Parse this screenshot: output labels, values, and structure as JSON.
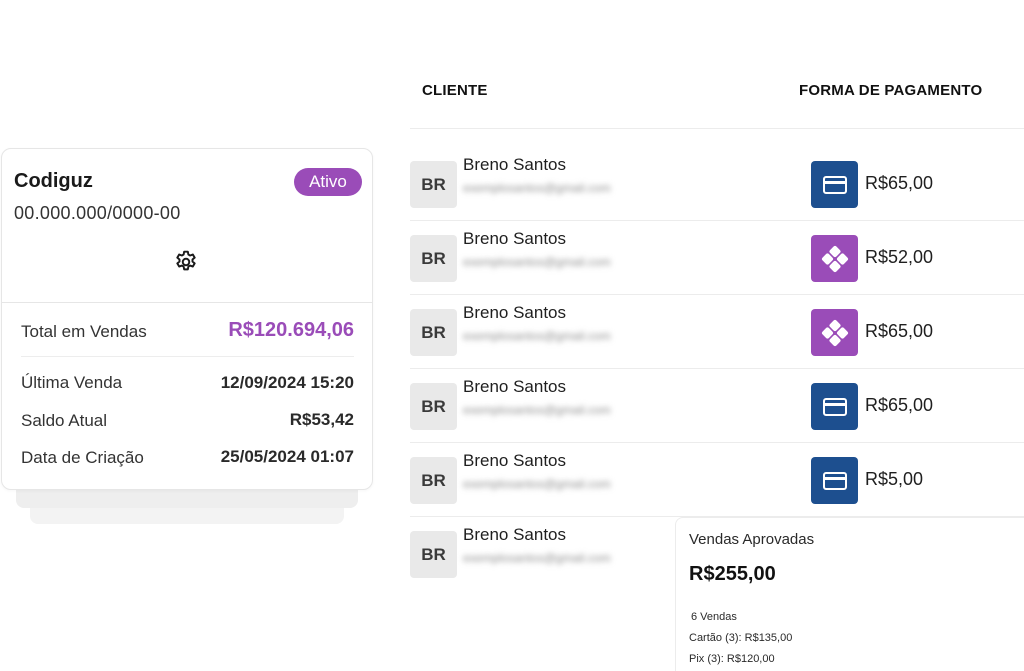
{
  "table": {
    "col_client": "CLIENTE",
    "col_payment": "FORMA DE PAGAMENTO",
    "rows": [
      {
        "initials": "BR",
        "name": "Breno Santos",
        "email": "exemplosantos@gmail.com",
        "method_icon": "credit-card-icon",
        "amount": "R$65,00"
      },
      {
        "initials": "BR",
        "name": "Breno Santos",
        "email": "exemplosantos@gmail.com",
        "method_icon": "pix-icon",
        "amount": "R$52,00"
      },
      {
        "initials": "BR",
        "name": "Breno Santos",
        "email": "exemplosantos@gmail.com",
        "method_icon": "pix-icon",
        "amount": "R$65,00"
      },
      {
        "initials": "BR",
        "name": "Breno Santos",
        "email": "exemplosantos@gmail.com",
        "method_icon": "credit-card-icon",
        "amount": "R$65,00"
      },
      {
        "initials": "BR",
        "name": "Breno Santos",
        "email": "exemplosantos@gmail.com",
        "method_icon": "credit-card-icon",
        "amount": "R$5,00"
      },
      {
        "initials": "BR",
        "name": "Breno Santos",
        "email": "exemplosantos@gmail.com"
      }
    ]
  },
  "summary": {
    "title": "Vendas Aprovadas",
    "total": "R$255,00",
    "count": "6 Vendas",
    "card_line": "Cartão (3): R$135,00",
    "pix_line": "Pix (3): R$120,00"
  },
  "store": {
    "name": "Codiguz",
    "status": "Ativo",
    "document": "00.000.000/0000-00",
    "total_label": "Total em Vendas",
    "total_value": "R$120.694,06",
    "last_sale_label": "Última Venda",
    "last_sale_value": "12/09/2024 15:20",
    "balance_label": "Saldo Atual",
    "balance_value": "R$53,42",
    "created_label": "Data de Criação",
    "created_value": "25/05/2024 01:07"
  },
  "colors": {
    "accent_purple": "#9a4cb8",
    "card_blue": "#1d4f8f"
  }
}
